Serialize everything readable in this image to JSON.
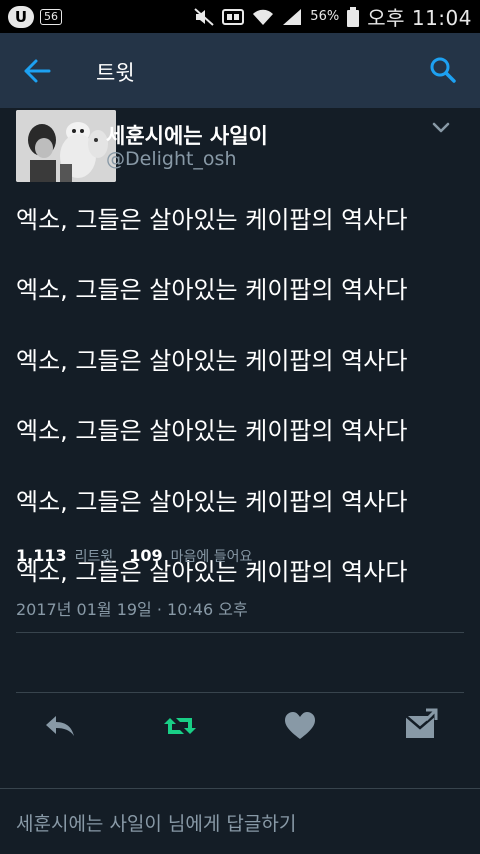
{
  "status_bar": {
    "carrier": "U",
    "badge": "56",
    "battery": "56%",
    "time": "오후 11:04"
  },
  "header": {
    "title": "트윗",
    "back_icon": "arrow-left-icon",
    "search_icon": "search-icon"
  },
  "tweet": {
    "author_name": "세훈시에는 사일이",
    "author_handle": "@Delight_osh",
    "lines": [
      "엑소, 그들은 살아있는 케이팝의 역사다",
      "엑소, 그들은 살아있는 케이팝의 역사다",
      "엑소, 그들은 살아있는 케이팝의 역사다",
      "엑소, 그들은 살아있는 케이팝의 역사다",
      "엑소, 그들은 살아있는 케이팝의 역사다",
      "엑소, 그들은 살아있는 케이팝의 역사다"
    ],
    "date": "2017년 01월 19일 · 10:46 오후"
  },
  "stats": {
    "retweet_count": "1,113",
    "retweet_label": "리트윗",
    "like_count": "109",
    "like_label": "마음에 들어요"
  },
  "actions": [
    "reply-icon",
    "retweet-icon",
    "heart-icon",
    "message-icon"
  ],
  "reply_bar": {
    "placeholder": "세훈시에는 사일이 님에게 답글하기"
  },
  "colors": {
    "background": "#141d26",
    "header": "#243447",
    "accent": "#1da1f2",
    "retweet_active": "#19cf86",
    "muted": "#8899a6"
  }
}
